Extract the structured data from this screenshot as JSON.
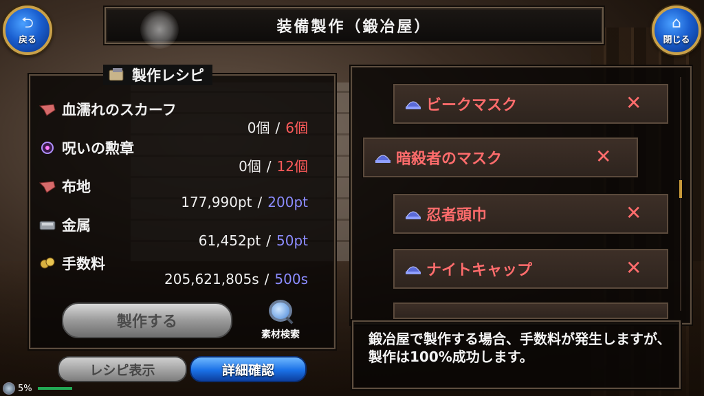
{
  "header": {
    "title": "装備製作（鍛冶屋）",
    "back_label": "戻る",
    "close_label": "閉じる"
  },
  "recipe_panel": {
    "title": "製作レシピ",
    "materials": [
      {
        "name": "血濡れのスカーフ",
        "have": "0個",
        "need": "6個",
        "icon": "scarf-icon",
        "need_color": "#ff5a5a"
      },
      {
        "name": "呪いの勲章",
        "have": "0個",
        "need": "12個",
        "icon": "medal-icon",
        "need_color": "#ff5a5a"
      },
      {
        "name": "布地",
        "have": "177,990pt",
        "need": "200pt",
        "icon": "cloth-icon",
        "need_color": "#8c8cff"
      },
      {
        "name": "金属",
        "have": "61,452pt",
        "need": "50pt",
        "icon": "metal-icon",
        "need_color": "#8c8cff"
      },
      {
        "name": "手数料",
        "have": "205,621,805s",
        "need": "500s",
        "icon": "coins-icon",
        "need_color": "#8c8cff"
      }
    ],
    "separator": "/",
    "craft_button": "製作する",
    "search_label": "素材検索"
  },
  "bottom_buttons": {
    "show_recipe": "レシピ表示",
    "details": "詳細確認"
  },
  "status": {
    "percent": "5%"
  },
  "recipes": [
    {
      "name": "ビークマスク",
      "mark": "✕",
      "selected": false
    },
    {
      "name": "暗殺者のマスク",
      "mark": "✕",
      "selected": true
    },
    {
      "name": "忍者頭巾",
      "mark": "✕",
      "selected": false
    },
    {
      "name": "ナイトキャップ",
      "mark": "✕",
      "selected": false
    }
  ],
  "message": "鍛冶屋で製作する場合、手数料が発生しますが、製作は100%成功します。",
  "colors": {
    "gold": "#c9a14a",
    "accent_blue": "#1a70e6",
    "unavailable": "#ff6c6c"
  }
}
